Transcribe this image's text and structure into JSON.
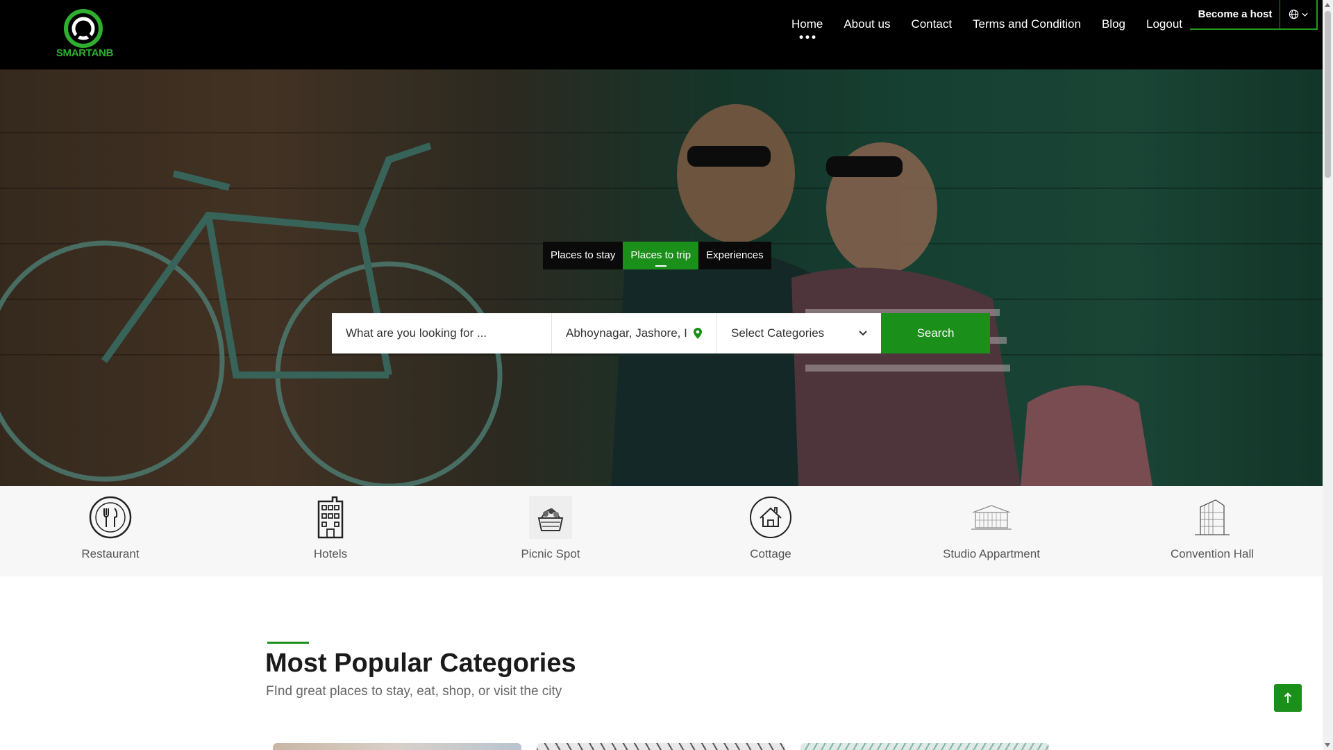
{
  "brand": {
    "name": "SMARTANB",
    "accent": "#1a8f1a"
  },
  "nav": {
    "items": [
      {
        "label": "Home",
        "active": true
      },
      {
        "label": "About us"
      },
      {
        "label": "Contact"
      },
      {
        "label": "Terms and Condition"
      },
      {
        "label": "Blog"
      },
      {
        "label": "Logout"
      }
    ],
    "host_label": "Become a host",
    "lang_icon": "globe-icon"
  },
  "hero": {
    "tabs": [
      {
        "label": "Places to stay"
      },
      {
        "label": "Places to trip",
        "active": true
      },
      {
        "label": "Experiences"
      }
    ],
    "search": {
      "what_placeholder": "What are you looking for ...",
      "location_value": "Abhoynagar, Jashore, I",
      "category_value": "Select Categories",
      "button_label": "Search"
    }
  },
  "categories": [
    {
      "label": "Restaurant",
      "icon": "restaurant-icon"
    },
    {
      "label": "Hotels",
      "icon": "hotel-icon"
    },
    {
      "label": "Picnic Spot",
      "icon": "picnic-icon"
    },
    {
      "label": "Cottage",
      "icon": "cottage-icon"
    },
    {
      "label": "Studio Appartment",
      "icon": "studio-icon"
    },
    {
      "label": "Convention Hall",
      "icon": "convention-hall-icon"
    }
  ],
  "popular": {
    "title": "Most Popular Categories",
    "subtitle": "FInd great places to stay, eat, shop, or visit the city"
  }
}
